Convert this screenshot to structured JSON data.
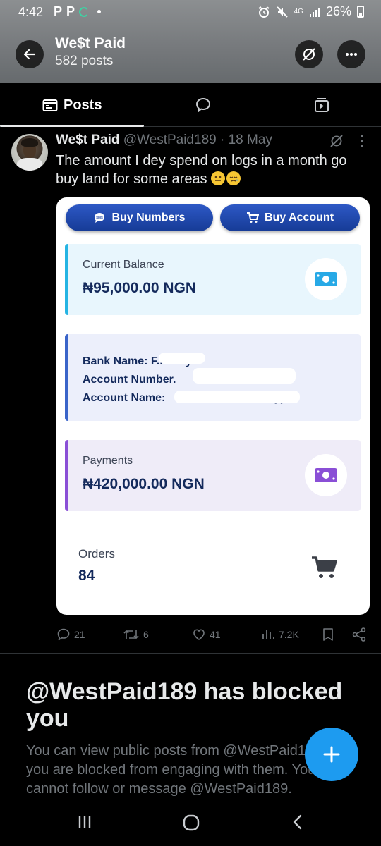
{
  "status_bar": {
    "time": "4:42",
    "app_letters": [
      "P",
      "P"
    ],
    "network": "4G",
    "battery": "26%"
  },
  "header": {
    "title": "We$t Paid",
    "post_count": "582 posts"
  },
  "tabs": [
    {
      "label": "Posts",
      "icon": "posts-list-icon",
      "active": true
    },
    {
      "label": "",
      "icon": "speech-bubble-icon",
      "active": false
    },
    {
      "label": "",
      "icon": "media-play-icon",
      "active": false
    }
  ],
  "post": {
    "display_name": "We$t Paid",
    "handle": "@WestPaid189",
    "date": "18 May",
    "text": "The amount I dey spend on logs in a month go buy land for some areas",
    "emojis": [
      "grimacing-face",
      "sleepy-face"
    ],
    "card": {
      "buttons": [
        "Buy Numbers",
        "Buy Account"
      ],
      "balance_label": "Current Balance",
      "balance_value": "₦95,000.00 NGN",
      "bank_lines": [
        "Bank Name: ",
        "Account Number. ",
        "Account Name: "
      ],
      "bank_trailing": [
        "F...... uy",
        "",
        "y)"
      ],
      "payments_label": "Payments",
      "payments_value": "₦420,000.00 NGN",
      "orders_label": "Orders",
      "orders_value": "84",
      "colors": {
        "balance_accent": "#25b4e3",
        "bank_accent": "#3a64c9",
        "payments_accent": "#8a4fd6",
        "button_blue": "#1f47a8"
      }
    },
    "stats": {
      "replies": "21",
      "reposts": "6",
      "likes": "41",
      "views": "7.2K"
    }
  },
  "blocked": {
    "title": "@WestPaid189 has blocked you",
    "body": "You can view public posts from @WestPaid189 but you are blocked from engaging with them. You also cannot follow or message @WestPaid189."
  },
  "accent": "#1d9bf0"
}
